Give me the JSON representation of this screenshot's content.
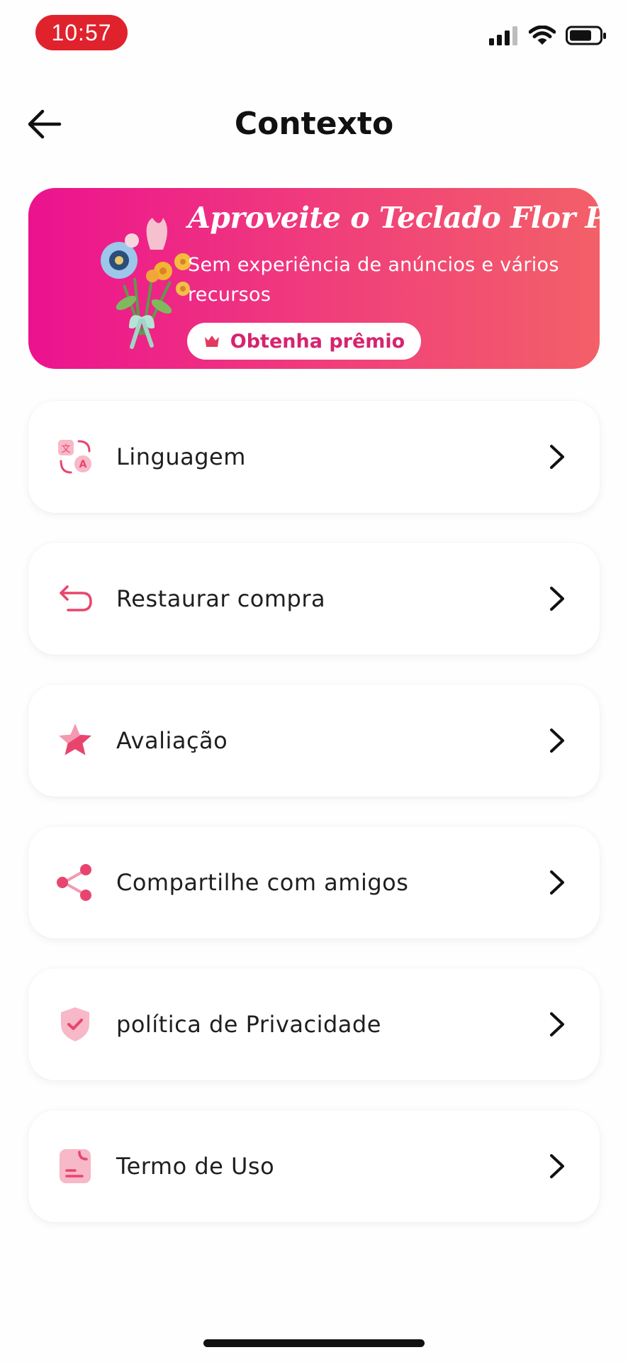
{
  "status_bar": {
    "time": "10:57",
    "icons": [
      "cellular-signal-icon",
      "wifi-icon",
      "battery-icon"
    ],
    "time_pill_color": "#e0222d"
  },
  "header": {
    "title": "Contexto",
    "back_icon": "arrow-left-icon"
  },
  "promo": {
    "title": "Aproveite o Teclado Flor Pro",
    "subtitle": "Sem experiência de anúncios e vários recursos",
    "button_label": "Obtenha prêmio",
    "button_icon": "crown-icon",
    "illustration": "flower-bouquet",
    "gradient_start": "#ec128f",
    "gradient_end": "#f36068"
  },
  "menu": {
    "items": [
      {
        "label": "Linguagem",
        "icon": "translate-icon"
      },
      {
        "label": "Restaurar compra",
        "icon": "undo-arrow-icon"
      },
      {
        "label": "Avaliação",
        "icon": "star-icon"
      },
      {
        "label": "Compartilhe com amigos",
        "icon": "share-icon"
      },
      {
        "label": "política de Privacidade",
        "icon": "shield-check-icon"
      },
      {
        "label": "Termo de Uso",
        "icon": "document-icon"
      }
    ],
    "accent_color": "#e8456e"
  }
}
